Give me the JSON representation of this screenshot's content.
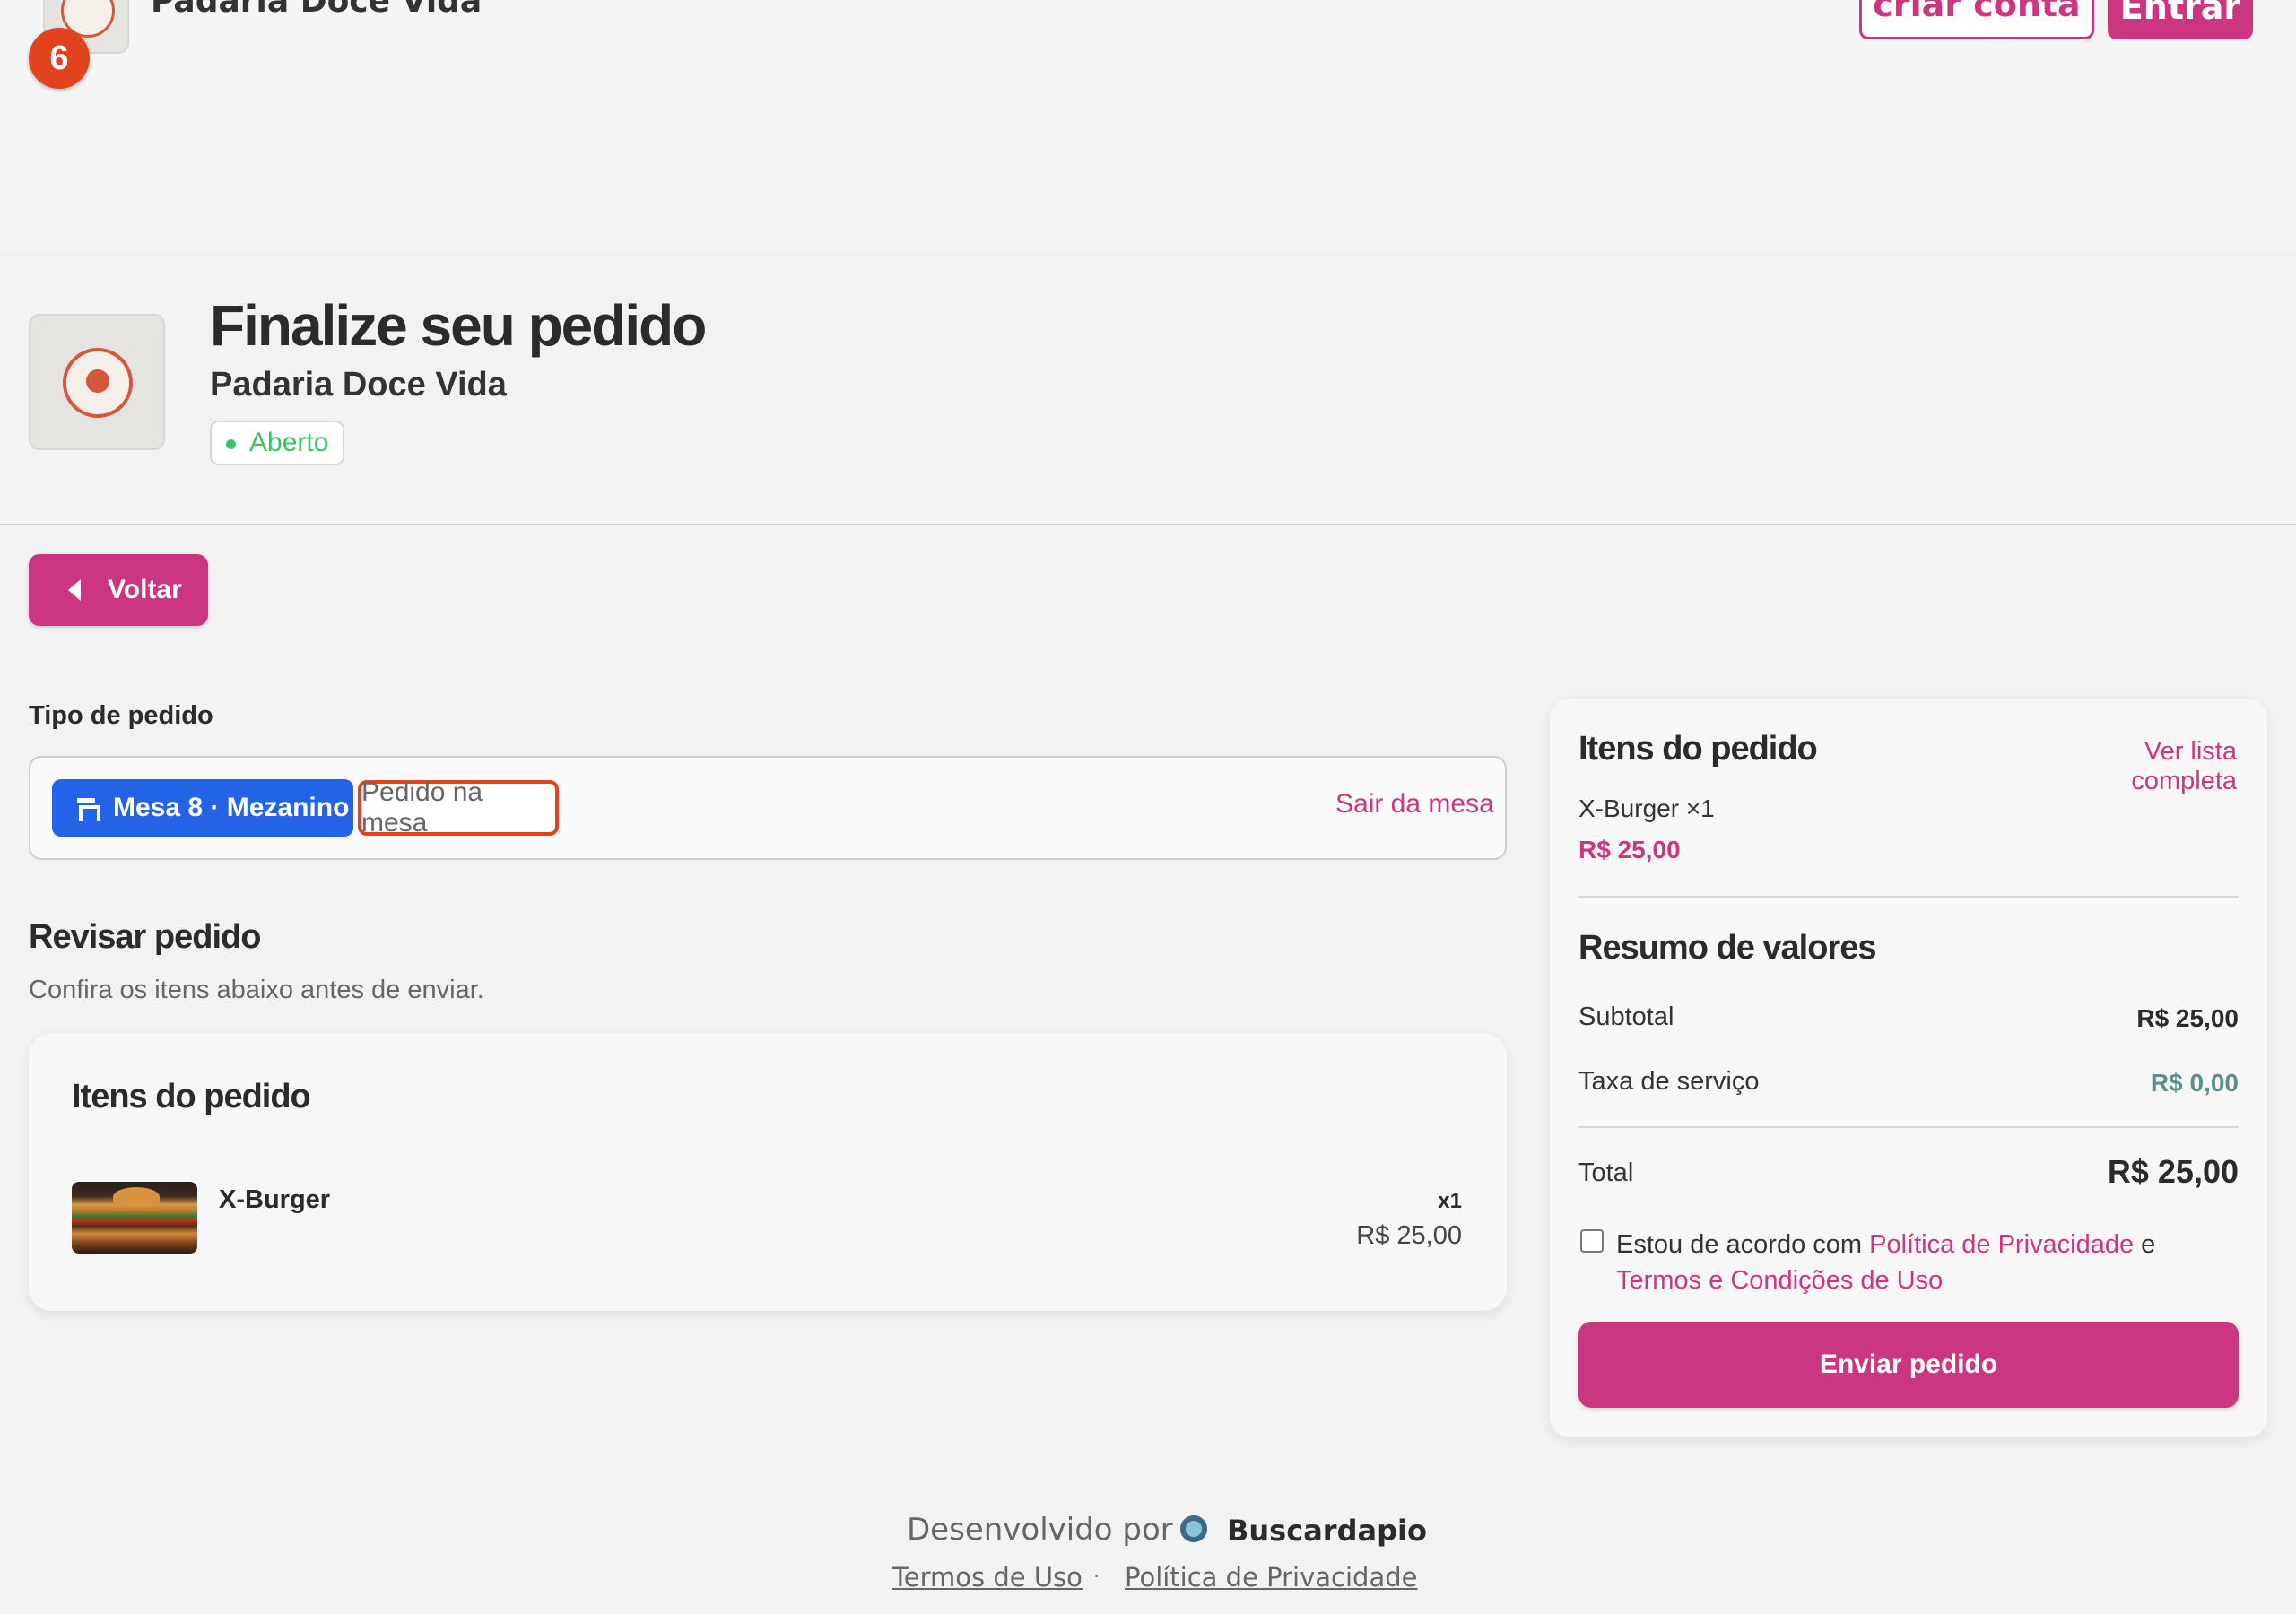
{
  "header": {
    "store_name": "Padaria Doce Vida",
    "badge_count": "6",
    "create_account_label": "criar conta",
    "login_label": "Entrar"
  },
  "store": {
    "page_title": "Finalize seu pedido",
    "name": "Padaria Doce Vida",
    "status": "Aberto"
  },
  "nav": {
    "back_label": "Voltar"
  },
  "order_type": {
    "label": "Tipo de pedido",
    "table_chip": "Mesa 8 · Mezanino",
    "mode": "Pedido na mesa",
    "leave_table": "Sair da mesa"
  },
  "review": {
    "title": "Revisar pedido",
    "subtitle": "Confira os itens abaixo antes de enviar.",
    "card_title": "Itens do pedido",
    "items": [
      {
        "name": "X-Burger",
        "qty": "x1",
        "price": "R$ 25,00",
        "image": "x-burger-photo"
      }
    ]
  },
  "summary": {
    "items_title": "Itens do pedido",
    "view_full_list": "Ver lista completa",
    "items": [
      {
        "name": "X-Burger ×1",
        "price": "R$ 25,00"
      }
    ],
    "values_title": "Resumo de valores",
    "subtotal_label": "Subtotal",
    "subtotal_value": "R$ 25,00",
    "service_fee_label": "Taxa de serviço",
    "service_fee_value": "R$ 0,00",
    "total_label": "Total",
    "total_value": "R$ 25,00",
    "agree_prefix": "Estou de acordo com",
    "privacy_link": "Política de Privacidade",
    "agree_and": "e",
    "terms_link": "Termos e Condições de Uso",
    "submit_label": "Enviar pedido"
  },
  "footer": {
    "developed_by": "Desenvolvido por",
    "brand": "Buscardapio",
    "terms": "Termos de Uso",
    "separator": "·",
    "privacy": "Política de Privacidade"
  },
  "colors": {
    "brand": "#cc3580",
    "table_chip": "#2462e8",
    "status_open": "#3fbf6a",
    "highlight": "#e2431f"
  }
}
